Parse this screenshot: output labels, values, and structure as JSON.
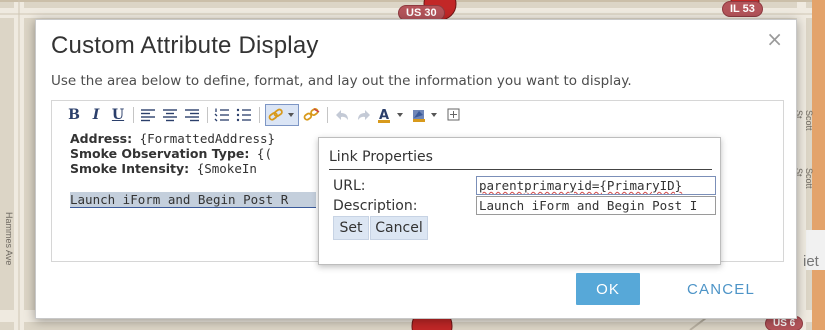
{
  "map": {
    "shields": [
      "US 30",
      "IL 53",
      "US 6"
    ],
    "street_labels": [
      "Hammes Ave",
      "Scott St",
      "Scott St",
      "iet"
    ],
    "colors": {
      "background": "#dcd5c6",
      "road": "#efeae0",
      "shield": "#b4545a",
      "marker": "#c22727"
    }
  },
  "dialog": {
    "title": "Custom Attribute Display",
    "close_glyph": "×",
    "instructions": "Use the area below to define, format, and lay out the information you want to display."
  },
  "toolbar": {
    "bold": "B",
    "italic": "I",
    "underline": "U",
    "icons": [
      "bold-icon",
      "italic-icon",
      "underline-icon",
      "align-left-icon",
      "align-center-icon",
      "align-right-icon",
      "numbered-list-icon",
      "bulleted-list-icon",
      "create-link-icon",
      "remove-link-icon",
      "undo-icon",
      "redo-icon",
      "font-color-icon",
      "highlight-color-icon",
      "insert-table-icon"
    ]
  },
  "content": {
    "lines": [
      {
        "label": "Address:",
        "value": "{FormattedAddress}"
      },
      {
        "label": "Smoke Observation Type:",
        "value": "{("
      },
      {
        "label": "Smoke Intensity:",
        "value": "{SmokeIn"
      }
    ],
    "link_text": "Launch iForm and Begin Post R"
  },
  "link_properties": {
    "title": "Link Properties",
    "url_label": "URL:",
    "url_value": "parentprimaryid={PrimaryID}",
    "description_label": "Description:",
    "description_value": "Launch iForm and Begin Post I",
    "set_label": "Set",
    "cancel_label": "Cancel"
  },
  "footer": {
    "ok_label": "OK",
    "cancel_label": "CANCEL",
    "ok_color": "#57a8d8",
    "cancel_color": "#4d94c7"
  }
}
